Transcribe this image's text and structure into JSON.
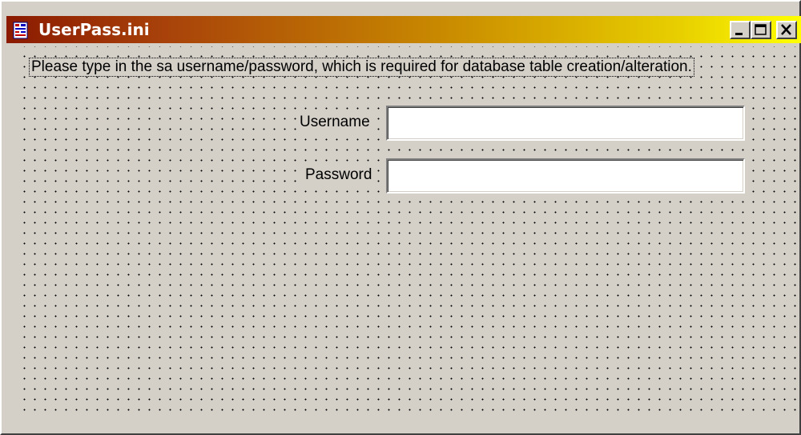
{
  "window": {
    "title": "UserPass.ini",
    "icon": "ini-file-icon",
    "controls": {
      "minimize_icon": "minimize-icon",
      "maximize_icon": "maximize-icon",
      "close_icon": "close-icon"
    }
  },
  "form": {
    "instruction": "Please type in the sa username/password, which is required for database table creation/alteration.",
    "username_label": "Username",
    "username_value": "",
    "password_label": "Password",
    "password_value": ""
  },
  "colors": {
    "title_gradient_start": "#8b1a00",
    "title_gradient_end": "#ffff00",
    "window_background": "#d4d0c8",
    "field_background": "#ffffff"
  }
}
